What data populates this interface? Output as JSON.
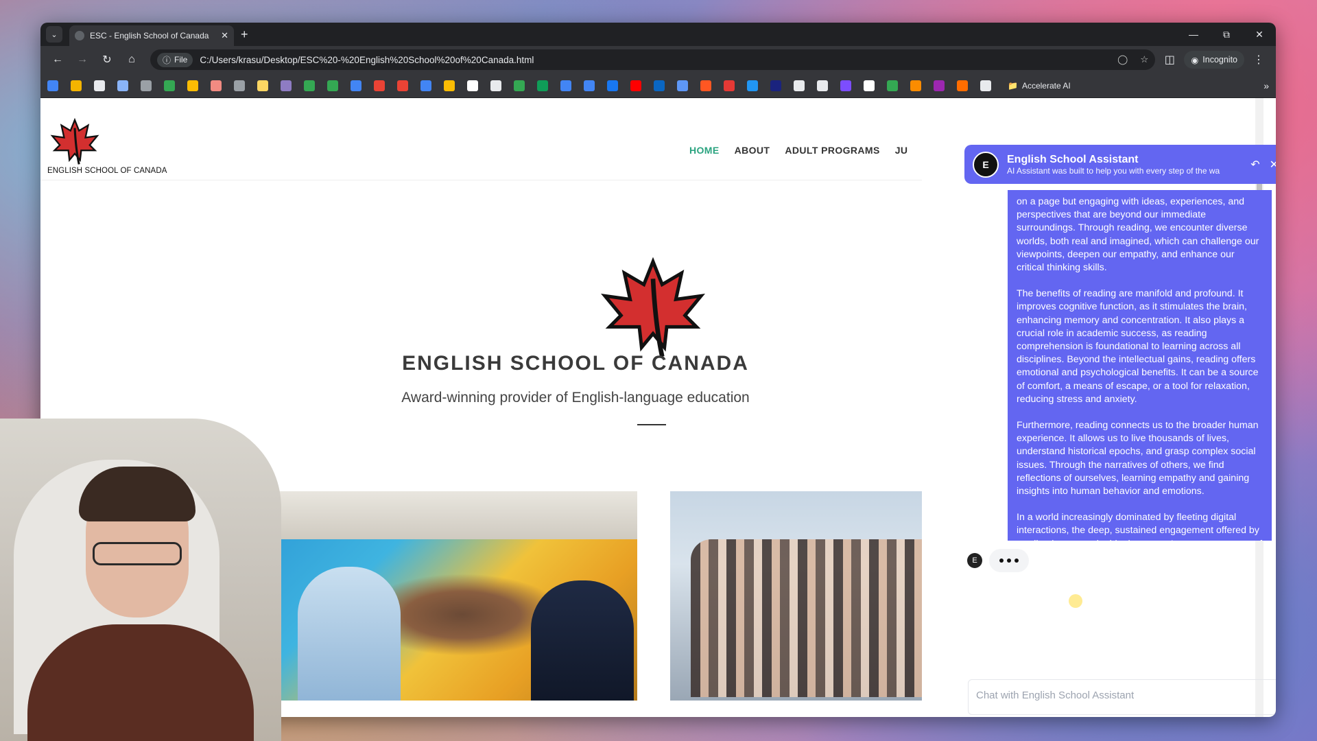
{
  "browser": {
    "tab_title": "ESC - English School of Canada",
    "address_chip": "File",
    "url": "C:/Users/krasu/Desktop/ESC%20-%20English%20School%20of%20Canada.html",
    "incognito_label": "Incognito",
    "bookmark_folder": "Accelerate AI",
    "bookmark_colors": [
      "#4285f4",
      "#f4b400",
      "#e8eaed",
      "#8ab4f8",
      "#9aa0a6",
      "#34a853",
      "#fbbc04",
      "#f28b82",
      "#9aa0a6",
      "#fdd663",
      "#8e7cc3",
      "#34a853",
      "#34a853",
      "#4285f4",
      "#ea4335",
      "#ea4335",
      "#4285f4",
      "#fbbc04",
      "#ffffff",
      "#e8eaed",
      "#34a853",
      "#0f9d58",
      "#4285f4",
      "#4285f4",
      "#1877f2",
      "#ff0000",
      "#0a66c2",
      "#5e97f6",
      "#ff5722",
      "#e53935",
      "#2196f3",
      "#1a237e",
      "#e8eaed",
      "#e8eaed",
      "#7c4dff",
      "#ffffff",
      "#34a853",
      "#fb8c00",
      "#9c27b0",
      "#ff6d00",
      "#e8eaed"
    ]
  },
  "site": {
    "brand_small": "ENGLISH SCHOOL OF CANADA",
    "nav": [
      "HOME",
      "ABOUT",
      "ADULT PROGRAMS",
      "JU"
    ],
    "hero_title": "ENGLISH SCHOOL OF CANADA",
    "hero_subtitle": "Award-winning provider of English-language education"
  },
  "chat": {
    "avatar_letter": "E",
    "title": "English School Assistant",
    "subtitle": "AI Assistant was built to help you with every step of the wa",
    "message_paragraphs": [
      "on a page but engaging with ideas, experiences, and perspectives that are beyond our immediate surroundings. Through reading, we encounter diverse worlds, both real and imagined, which can challenge our viewpoints, deepen our empathy, and enhance our critical thinking skills.",
      "The benefits of reading are manifold and profound. It improves cognitive function, as it stimulates the brain, enhancing memory and concentration. It also plays a crucial role in academic success, as reading comprehension is foundational to learning across all disciplines. Beyond the intellectual gains, reading offers emotional and psychological benefits. It can be a source of comfort, a means of escape, or a tool for relaxation, reducing stress and anxiety.",
      "Furthermore, reading connects us to the broader human experience. It allows us to live thousands of lives, understand historical epochs, and grasp complex social issues. Through the narratives of others, we find reflections of ourselves, learning empathy and gaining insights into human behavior and emotions.",
      "In a world increasingly dominated by fleeting digital interactions, the deep, sustained engagement offered by reading is more valuable than ever. It nurtures a sense of curiosity, fosters imagination, and equips us with the knowledge to navigate the complexities of life. Reading, in essence, is an act of empowerment, a lifelong journey that enriches the mind and soul."
    ],
    "input_placeholder": "Chat with English School Assistant",
    "accent_color": "#6366f1"
  }
}
